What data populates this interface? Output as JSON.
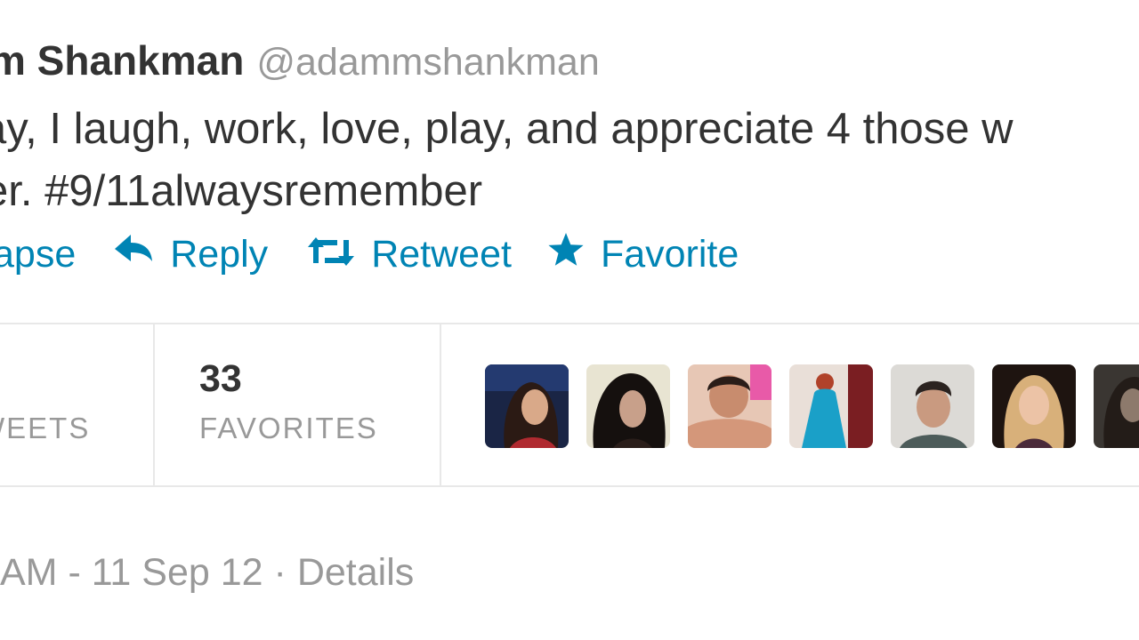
{
  "tweet": {
    "author_name": "m Shankman",
    "author_handle": "@adammshankman",
    "text_line1": "ay, I laugh, work, love, play, and appreciate 4 those w",
    "text_line2": "er. #9/11alwaysremember"
  },
  "actions": {
    "collapse_label": "apse",
    "reply_label": "Reply",
    "retweet_label": "Retweet",
    "favorite_label": "Favorite"
  },
  "stats": {
    "retweets_label": "WEETS",
    "favorites_count": "33",
    "favorites_label": "FAVORITES"
  },
  "avatars": [
    {
      "name": "favoriter-avatar-1",
      "icon": "user-photo"
    },
    {
      "name": "favoriter-avatar-2",
      "icon": "user-photo"
    },
    {
      "name": "favoriter-avatar-3",
      "icon": "user-photo"
    },
    {
      "name": "favoriter-avatar-4",
      "icon": "user-photo"
    },
    {
      "name": "favoriter-avatar-5",
      "icon": "user-photo"
    },
    {
      "name": "favoriter-avatar-6",
      "icon": "user-photo"
    },
    {
      "name": "favoriter-avatar-7",
      "icon": "user-photo"
    }
  ],
  "meta": {
    "timestamp": "AM - 11 Sep 12",
    "separator": "·",
    "details_label": "Details"
  },
  "colors": {
    "link": "#0084b4",
    "text": "#333333",
    "muted": "#999999",
    "divider": "#e8e8e8"
  }
}
